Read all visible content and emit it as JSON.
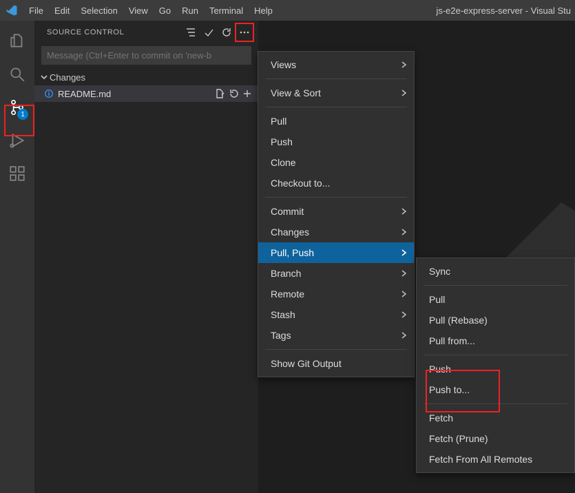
{
  "menubar": {
    "items": [
      "File",
      "Edit",
      "Selection",
      "View",
      "Go",
      "Run",
      "Terminal",
      "Help"
    ],
    "title": "js-e2e-express-server - Visual Stu"
  },
  "activitybar": {
    "scm_badge": "1"
  },
  "sidebar": {
    "title": "SOURCE CONTROL",
    "commit_placeholder": "Message (Ctrl+Enter to commit on 'new-b",
    "changes_label": "Changes",
    "file": {
      "name": "README.md"
    }
  },
  "menu1": {
    "views": "Views",
    "viewsort": "View & Sort",
    "pull": "Pull",
    "push": "Push",
    "clone": "Clone",
    "checkout": "Checkout to...",
    "commit": "Commit",
    "changes": "Changes",
    "pullpush": "Pull, Push",
    "branch": "Branch",
    "remote": "Remote",
    "stash": "Stash",
    "tags": "Tags",
    "showgit": "Show Git Output"
  },
  "menu2": {
    "sync": "Sync",
    "pull": "Pull",
    "pullrebase": "Pull (Rebase)",
    "pullfrom": "Pull from...",
    "push": "Push",
    "pushto": "Push to...",
    "fetch": "Fetch",
    "fetchprune": "Fetch (Prune)",
    "fetchall": "Fetch From All Remotes"
  }
}
